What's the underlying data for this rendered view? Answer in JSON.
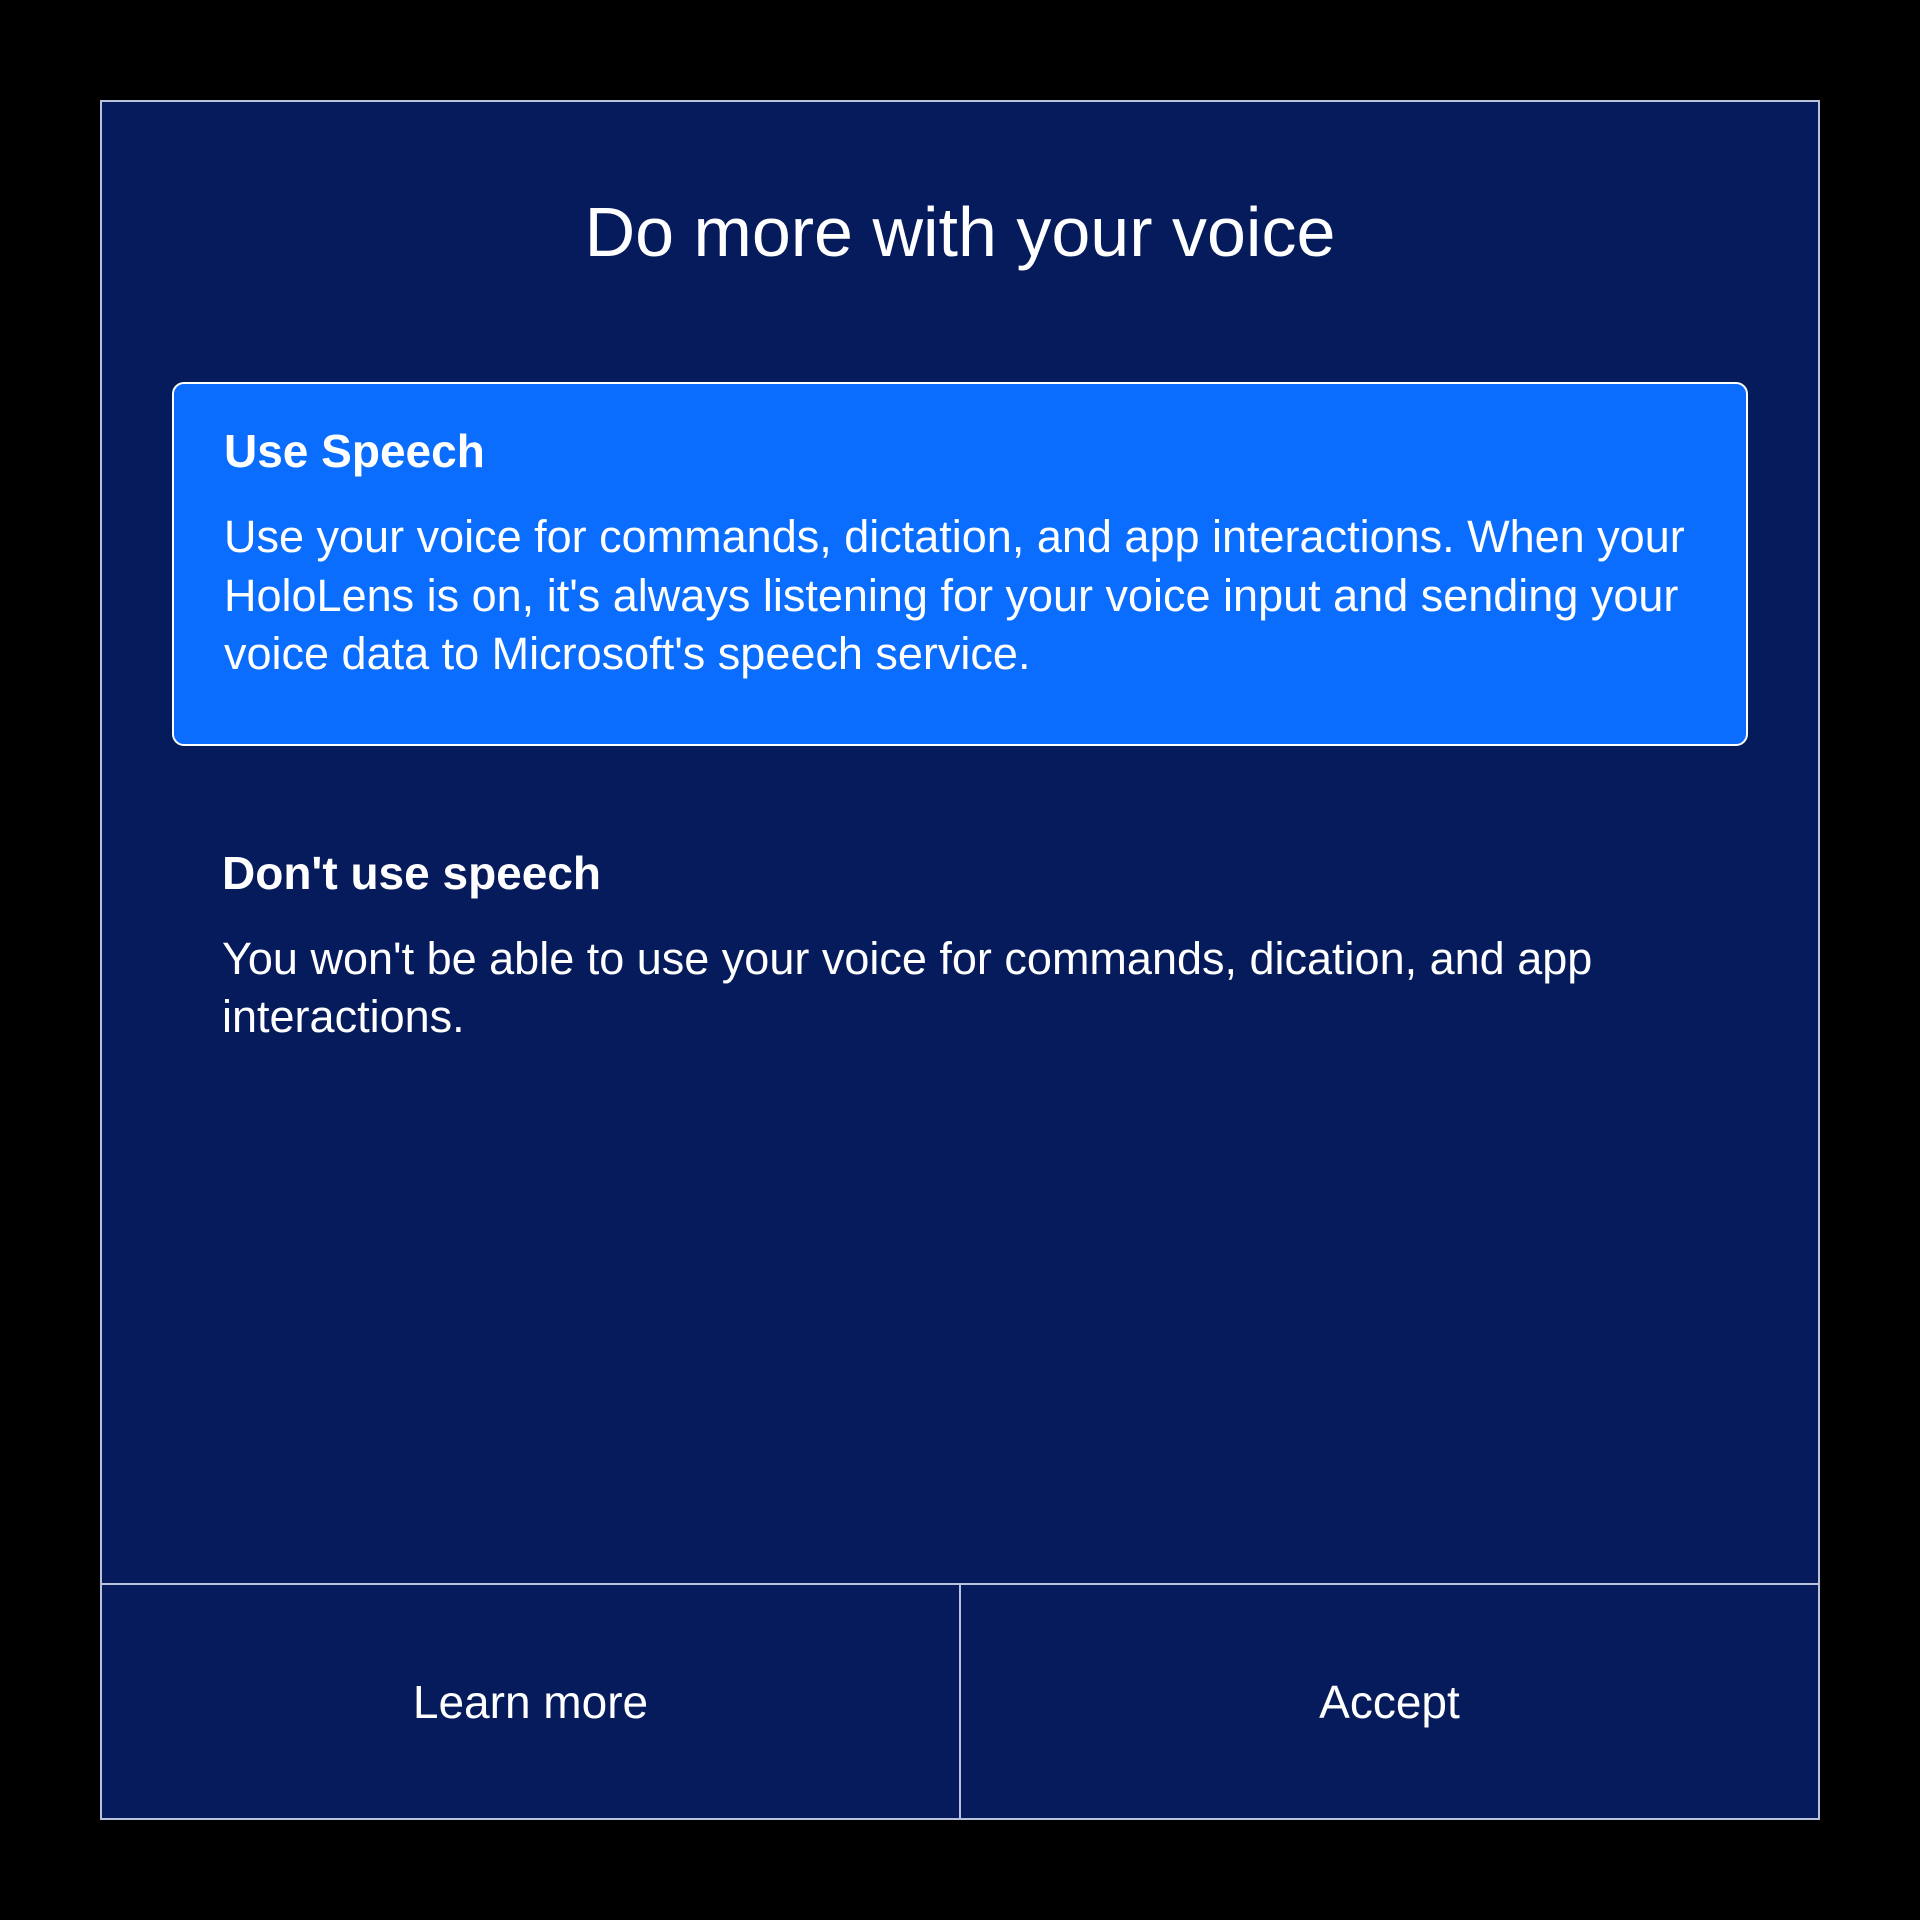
{
  "dialog": {
    "title": "Do more with your voice",
    "options": [
      {
        "title": "Use Speech",
        "description": "Use your voice for commands, dictation, and app interactions. When your HoloLens is on, it's always listening for your voice input and sending your voice data to Microsoft's speech service.",
        "selected": true
      },
      {
        "title": "Don't use speech",
        "description": "You won't be able to use your voice for commands, dication, and app interactions.",
        "selected": false
      }
    ],
    "footer": {
      "learn_more_label": "Learn more",
      "accept_label": "Accept"
    }
  },
  "colors": {
    "background": "#061b5c",
    "selected_option": "#0a6dfe",
    "border": "#b8c2dc",
    "text": "#ffffff"
  }
}
